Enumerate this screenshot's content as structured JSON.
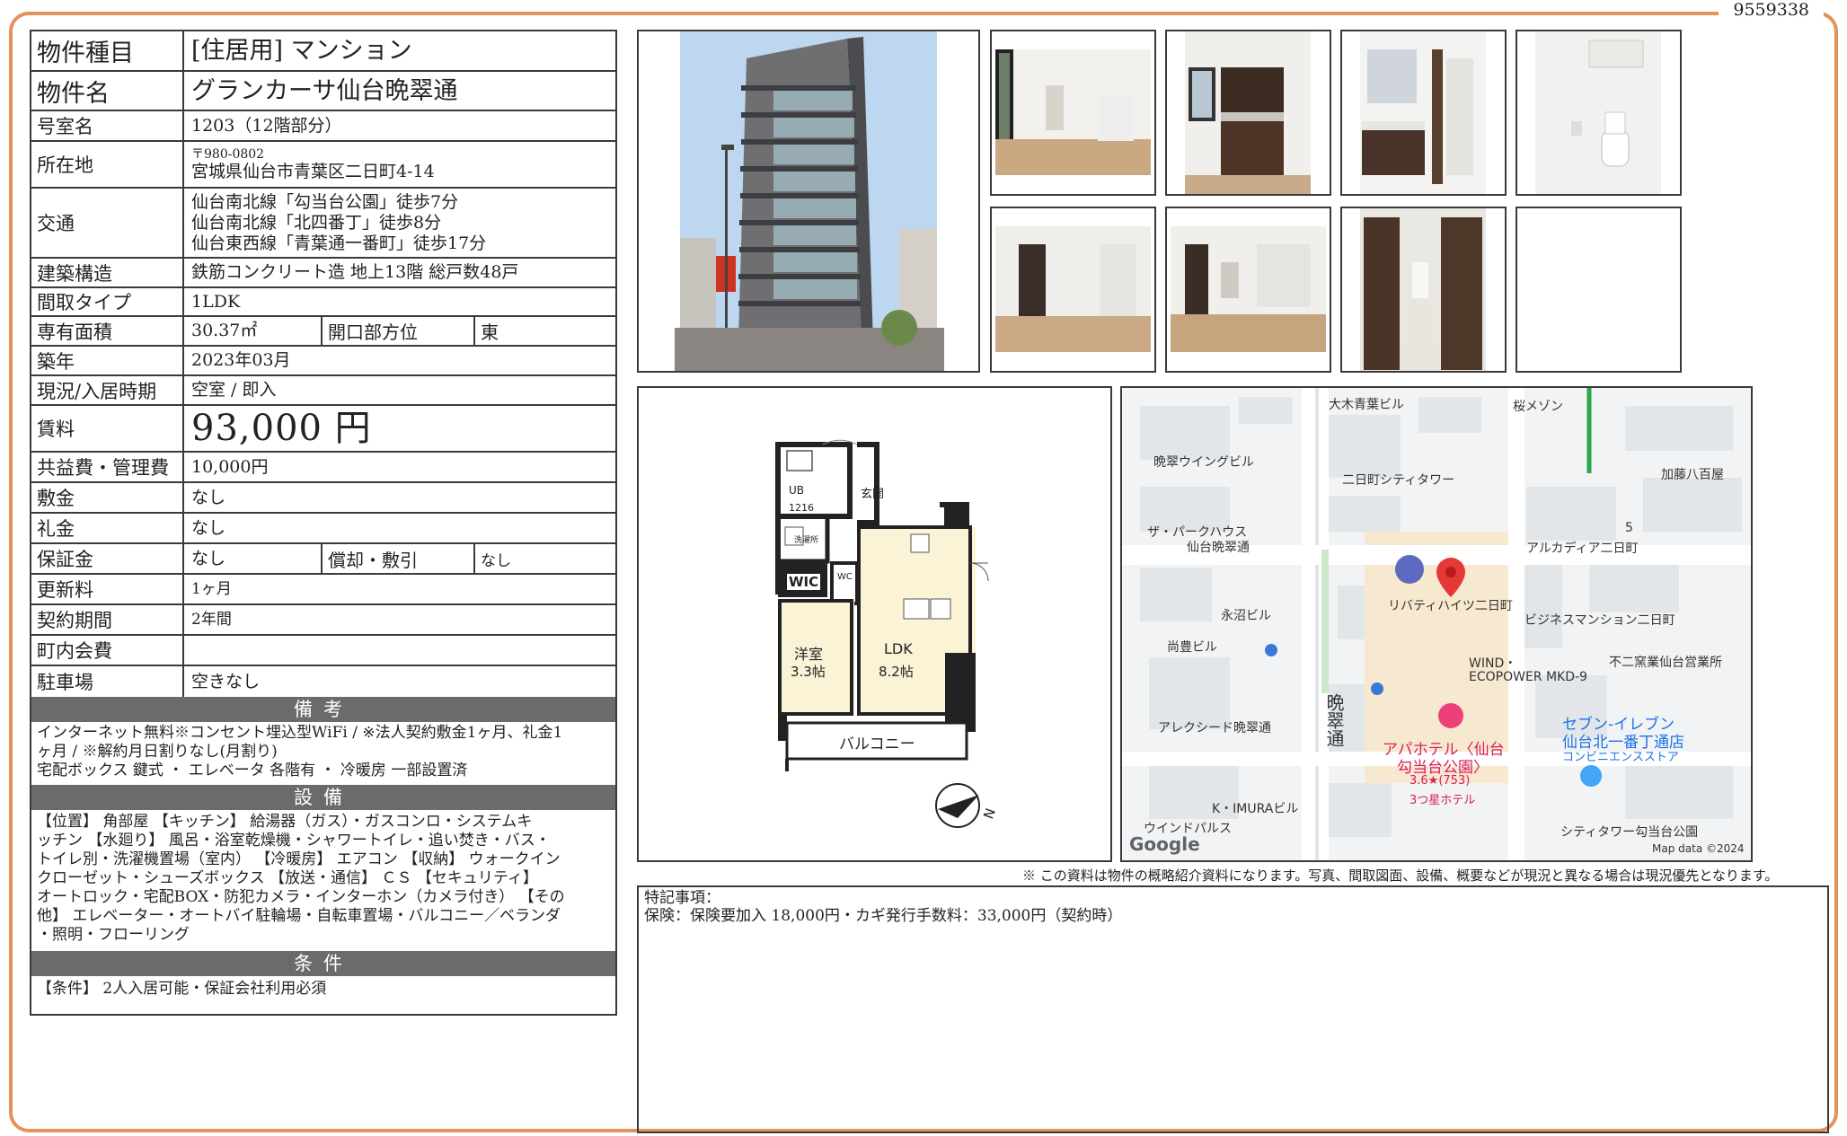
{
  "doc_id": "9559338",
  "table": {
    "type_label": "物件種目",
    "type_value": "[住居用] マンション",
    "name_label": "物件名",
    "name_value": "グランカーサ仙台晩翠通",
    "room_label": "号室名",
    "room_value": "1203（12階部分）",
    "addr_label": "所在地",
    "addr_zip": "〒980-0802",
    "addr_value": "宮城県仙台市青葉区二日町4-14",
    "access_label": "交通",
    "access_lines": [
      "仙台南北線「勾当台公園」徒歩7分",
      "仙台南北線「北四番丁」徒歩8分",
      "仙台東西線「青葉通一番町」徒歩17分"
    ],
    "struct_label": "建築構造",
    "struct_value": "鉄筋コンクリート造 地上13階 総戸数48戸",
    "layout_label": "間取タイプ",
    "layout_value": "1LDK",
    "area_label": "専有面積",
    "area_value": "30.37㎡",
    "dir_label": "開口部方位",
    "dir_value": "東",
    "built_label": "築年",
    "built_value": "2023年03月",
    "status_label": "現況/入居時期",
    "status_value": "空室 / 即入",
    "rent_label": "賃料",
    "rent_value": "93,000 円",
    "fee_label": "共益費・管理費",
    "fee_value": "10,000円",
    "deposit_label": "敷金",
    "deposit_value": "なし",
    "keymoney_label": "礼金",
    "keymoney_value": "なし",
    "guarantee_label": "保証金",
    "guarantee_value": "なし",
    "amort_label": "償却・敷引",
    "amort_value": "なし",
    "renew_label": "更新料",
    "renew_value": "1ヶ月",
    "term_label": "契約期間",
    "term_value": "2年間",
    "assoc_label": "町内会費",
    "assoc_value": "",
    "parking_label": "駐車場",
    "parking_value": "空きなし"
  },
  "remarks_band": "備考",
  "remarks_lines": [
    "インターネット無料※コンセント埋込型WiFi / ※法人契約敷金1ヶ月、礼金1",
    "ヶ月 / ※解約月日割りなし(月割り)",
    "宅配ボックス 鍵式 ・ エレベータ 各階有 ・ 冷暖房 一部設置済"
  ],
  "equip_band": "設備",
  "equip_lines": [
    "【位置】 角部屋 【キッチン】 給湯器（ガス）・ガスコンロ・システムキ",
    "ッチン 【水廻り】 風呂・浴室乾燥機・シャワートイレ・追い焚き・バス・",
    "トイレ別・洗濯機置場（室内） 【冷暖房】 エアコン 【収納】 ウォークイン",
    "クローゼット・シューズボックス 【放送・通信】 ＣＳ 【セキュリティ】",
    "オートロック・宅配BOX・防犯カメラ・インターホン（カメラ付き） 【その",
    "他】 エレベーター・オートバイ駐輪場・自転車置場・バルコニー／ベランダ",
    "・照明・フローリング"
  ],
  "cond_band": "条件",
  "cond_line": "【条件】 2人入居可能・保証会社利用必須",
  "floorplan": {
    "ub": "UB",
    "ub_size": "1216",
    "genkan": "玄関",
    "sentaku": "洗濯所",
    "wic": "WIC",
    "wc": "WC",
    "yoshitsu": "洋室",
    "yoshitsu_size": "3.3帖",
    "ldk": "LDK",
    "ldk_size": "8.2帖",
    "balcony": "バルコニー",
    "north": "N"
  },
  "map": {
    "labels": [
      "大木青葉ビル",
      "桜メゾン",
      "晩翠ウイングビル",
      "二日町シティタワー",
      "加藤八百屋",
      "ザ・パークハウス",
      "仙台晩翠通",
      "アルカディア二日町",
      "5",
      "永沼ビル",
      "尚豊ビル",
      "リバティハイツ二日町",
      "ビジネスマンション二日町",
      "不二窯業仙台営業所",
      "WIND・",
      "ECOPOWER MKD-9",
      "晩翠通",
      "アレクシード晩翠通",
      "セブン-イレブン",
      "仙台北一番丁通店",
      "コンビニエンスストア",
      "アパホテル〈仙台",
      "勾当台公園〉",
      "3.6★(753)",
      "3つ星ホテル",
      "K・IMURAビル",
      "ウインドパルス",
      "シティタワー勾当台公園",
      "Google",
      "Map data ©2024"
    ]
  },
  "disclaimer": "※ この資料は物件の概略紹介資料になります。写真、間取図面、設備、概要などが現況と異なる場合は現況優先となります。",
  "special_title": "特記事項：",
  "special_line": "保険：保険要加入 18,000円・カギ発行手数料：33,000円（契約時）",
  "colors": {
    "frame": "#e5915b",
    "band": "#6b6b6b",
    "border": "#3a3a3a"
  }
}
